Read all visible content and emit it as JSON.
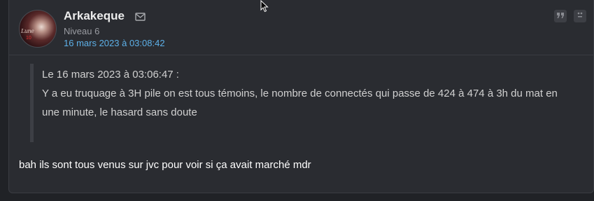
{
  "post": {
    "author": "Arkakeque",
    "avatar_text": "Lune",
    "avatar_subtext": "10",
    "level": "Niveau 6",
    "date": "16 mars 2023 à 03:08:42",
    "quote": {
      "header": "Le 16 mars 2023 à 03:06:47 :",
      "text": "Y a eu truquage à 3H pile on est tous témoins, le nombre de connectés qui passe de 424 à 474 à 3h du mat en une minute, le hasard sans doute"
    },
    "reply": "bah ils sont tous venus sur jvc pour voir si ça avait marché mdr"
  },
  "icons": {
    "mail": "mail-icon",
    "quote": "quote-icon",
    "report": "report-icon"
  },
  "colors": {
    "link": "#5db0e8",
    "background": "#2a2c31"
  }
}
